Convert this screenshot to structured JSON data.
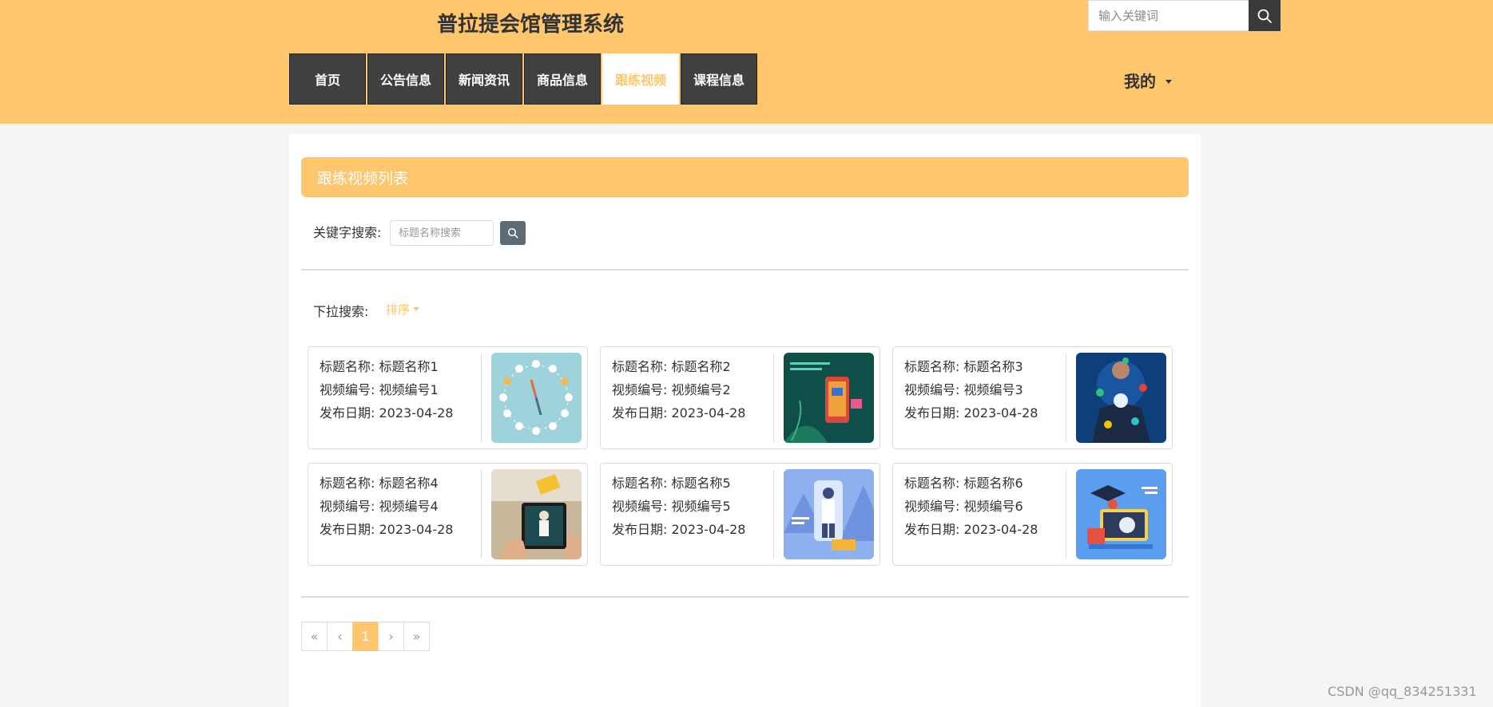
{
  "header": {
    "site_title": "普拉提会馆管理系统",
    "search_placeholder": "输入关键词",
    "search_icon": "search-icon",
    "nav": [
      {
        "label": "首页",
        "active": false
      },
      {
        "label": "公告信息",
        "active": false
      },
      {
        "label": "新闻资讯",
        "active": false
      },
      {
        "label": "商品信息",
        "active": false
      },
      {
        "label": "跟练视频",
        "active": true
      },
      {
        "label": "课程信息",
        "active": false
      }
    ],
    "user_menu": "我的"
  },
  "page": {
    "list_title": "跟练视频列表",
    "keyword_label": "关键字搜索:",
    "keyword_placeholder": "标题名称搜索",
    "dropdown_label": "下拉搜索:",
    "sort_label": "排序"
  },
  "cards": [
    {
      "title_line": "标题名称: 标题名称1",
      "code_line": "视频编号: 视频编号1",
      "date_line": "发布日期: 2023-04-28"
    },
    {
      "title_line": "标题名称: 标题名称2",
      "code_line": "视频编号: 视频编号2",
      "date_line": "发布日期: 2023-04-28"
    },
    {
      "title_line": "标题名称: 标题名称3",
      "code_line": "视频编号: 视频编号3",
      "date_line": "发布日期: 2023-04-28"
    },
    {
      "title_line": "标题名称: 标题名称4",
      "code_line": "视频编号: 视频编号4",
      "date_line": "发布日期: 2023-04-28"
    },
    {
      "title_line": "标题名称: 标题名称5",
      "code_line": "视频编号: 视频编号5",
      "date_line": "发布日期: 2023-04-28"
    },
    {
      "title_line": "标题名称: 标题名称6",
      "code_line": "视频编号: 视频编号6",
      "date_line": "发布日期: 2023-04-28"
    }
  ],
  "pagination": {
    "first": "«",
    "prev": "‹",
    "current": "1",
    "next": "›",
    "last": "»"
  },
  "watermark": "CSDN @qq_834251331",
  "colors": {
    "accent": "#fec66d",
    "nav_dark": "#404040"
  }
}
